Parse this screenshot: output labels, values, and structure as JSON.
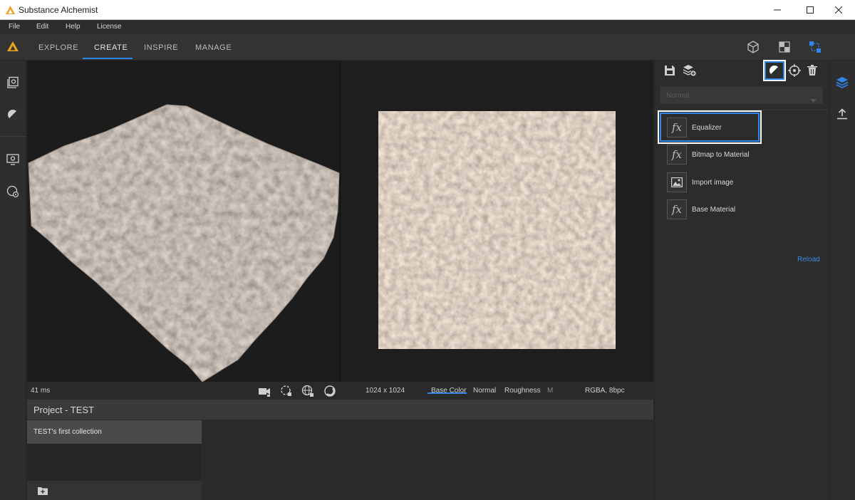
{
  "window": {
    "title": "Substance Alchemist",
    "accent": "#2f86e8"
  },
  "menu": [
    "File",
    "Edit",
    "Help",
    "License"
  ],
  "nav": {
    "tabs": [
      "EXPLORE",
      "CREATE",
      "INSPIRE",
      "MANAGE"
    ],
    "active_tab": "CREATE",
    "right_icons": [
      "cube-icon",
      "checker-icon",
      "nodes-icon"
    ]
  },
  "left_sidebar": {
    "icons": [
      "library-icon",
      "material-sphere-icon",
      "display-settings-icon",
      "render-settings-icon"
    ]
  },
  "viewport": {
    "render_time": "41 ms",
    "resolution": "1024 x 1024",
    "channels": [
      "Base Color",
      "Normal",
      "Roughness",
      "M"
    ],
    "active_channel": "Base Color",
    "format": "RGBA, 8bpc"
  },
  "project": {
    "title": "Project - TEST",
    "collections": [
      "TEST's first collection"
    ]
  },
  "layers_panel": {
    "blend_mode": "Normal",
    "layers": [
      {
        "name": "Equalizer",
        "icon": "fx-icon",
        "highlighted": true
      },
      {
        "name": "Bitmap to Material",
        "icon": "fx-icon",
        "highlighted": false
      },
      {
        "name": "Import image",
        "icon": "image-icon",
        "highlighted": false
      },
      {
        "name": "Base Material",
        "icon": "fx-icon",
        "highlighted": false
      }
    ],
    "reload_label": "Reload"
  },
  "right_strip": {
    "icons": [
      "layers-icon",
      "export-icon"
    ]
  }
}
